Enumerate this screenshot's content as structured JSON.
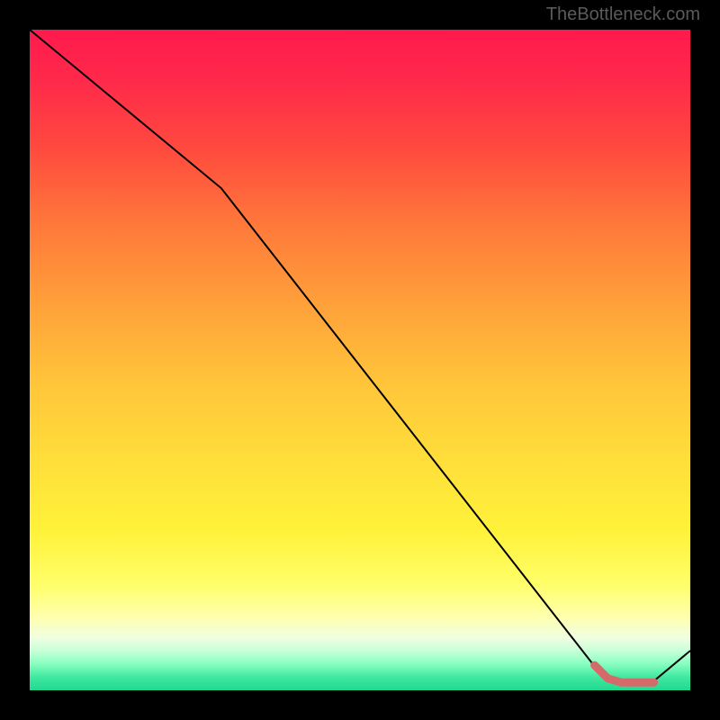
{
  "watermark": "TheBottleneck.com",
  "chart_data": {
    "type": "line",
    "title": "",
    "xlabel": "",
    "ylabel": "",
    "xlim": [
      0,
      100
    ],
    "ylim": [
      0,
      100
    ],
    "series": [
      {
        "name": "curve",
        "color": "#000000",
        "x": [
          0,
          29,
          86,
          90,
          94,
          100
        ],
        "values": [
          100,
          76,
          3,
          1,
          1,
          6
        ]
      },
      {
        "name": "highlight",
        "color": "#d46a6a",
        "style": "thick",
        "x": [
          85.5,
          87.5,
          89.5,
          94.5
        ],
        "values": [
          3.8,
          1.8,
          1.2,
          1.2
        ]
      }
    ]
  },
  "colors": {
    "background": "#000000",
    "watermark": "#5a5a5a",
    "gradient_top": "#ff1a4d",
    "gradient_bottom": "#20d890",
    "line": "#000000",
    "highlight": "#d46a6a"
  }
}
